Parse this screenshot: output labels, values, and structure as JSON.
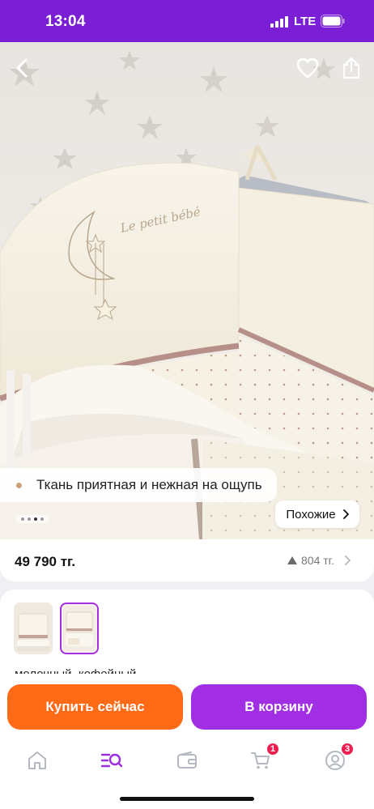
{
  "status_bar": {
    "time": "13:04",
    "network": "LTE",
    "icons": [
      "signal-icon",
      "battery-icon"
    ]
  },
  "hero": {
    "icons": [
      "back-arrow-icon",
      "heart-icon",
      "share-icon"
    ],
    "feature_text": "Ткань приятная и нежная на ощупь",
    "embroidery_text": "Le petit bébé",
    "similar_label": "Похожие",
    "gallery_dots": 4,
    "gallery_active_index": 2
  },
  "product": {
    "price": "49 790 тг.",
    "reviews_count": "804 тг."
  },
  "variants": {
    "selected_index": 1,
    "color_label": "молочный, кофейный"
  },
  "actions": {
    "buy_now": "Купить сейчас",
    "add_to_cart": "В корзину"
  },
  "tabbar": {
    "items": [
      "home-icon",
      "catalog-search-icon",
      "wallet-icon",
      "cart-icon",
      "profile-icon"
    ],
    "cart_badge": "1",
    "profile_badge": "3"
  },
  "colors": {
    "brand_purple": "#7a1fd6",
    "cart_button": "#a22ee3",
    "buy_button": "#ff6a17",
    "badge": "#ee1d4f"
  }
}
